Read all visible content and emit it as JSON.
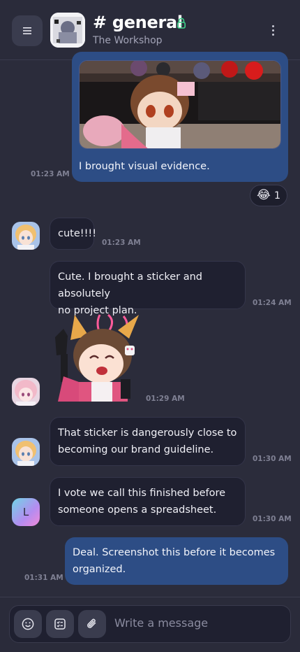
{
  "header": {
    "menu_icon": "hamburger-icon",
    "title": "# general",
    "subtitle": "The Workshop",
    "lock_icon": "lock-icon",
    "more_icon": "kebab-icon"
  },
  "messages": [
    {
      "id": "m1",
      "caption": "I brought visual evidence.",
      "time": "01:23 AM",
      "reaction": {
        "emoji": "😂",
        "count": "1"
      }
    },
    {
      "id": "m2",
      "text": "cute!!!!",
      "time": "01:23 AM"
    },
    {
      "id": "m3",
      "line1": "Cute. I brought a sticker and absolutely",
      "line2": "no project plan.",
      "time": "01:24 AM"
    },
    {
      "id": "m4",
      "time": "01:29 AM"
    },
    {
      "id": "m5",
      "line1": "That sticker is dangerously close to",
      "line2": "becoming our brand guideline.",
      "time": "01:30 AM"
    },
    {
      "id": "m6",
      "avatar_letter": "L",
      "line1": "I vote we call this finished before",
      "line2": "someone opens a spreadsheet.",
      "time": "01:30 AM"
    },
    {
      "id": "m7",
      "line1": "Deal. Screenshot this before it becomes",
      "line2": "organized.",
      "time": "01:31 AM"
    }
  ],
  "composer": {
    "placeholder": "Write a message",
    "emoji_icon": "smiley-icon",
    "checklist_icon": "checklist-icon",
    "attach_icon": "paperclip-icon"
  },
  "colors": {
    "background": "#2b2c3b",
    "outgoing_bubble": "#2d4d85",
    "incoming_bubble": "#1f2030",
    "lock": "#3fd28a"
  }
}
